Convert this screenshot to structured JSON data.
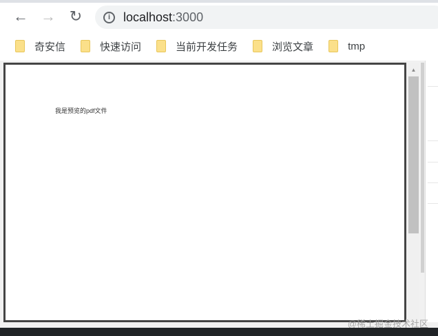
{
  "toolbar": {
    "back_icon": "arrow-left-icon",
    "forward_icon": "arrow-right-icon",
    "reload_icon": "reload-icon",
    "url_host": "localhost",
    "url_port": ":3000"
  },
  "bookmarks": [
    {
      "label": "奇安信"
    },
    {
      "label": "快速访问"
    },
    {
      "label": "当前开发任务"
    },
    {
      "label": "浏览文章"
    },
    {
      "label": "tmp"
    }
  ],
  "page": {
    "pdf_text": "我是预览的pdf文件"
  },
  "watermark": "@稀土掘金技术社区"
}
